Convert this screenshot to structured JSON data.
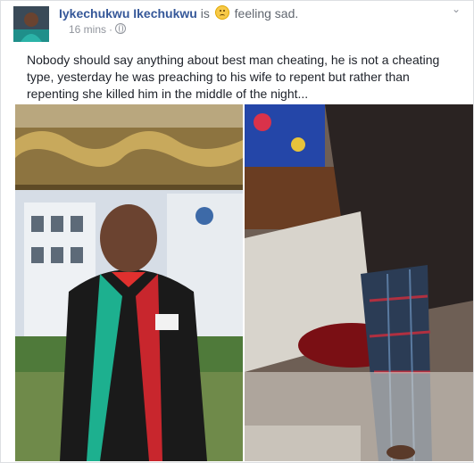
{
  "post": {
    "author": "Iykechukwu Ikechukwu",
    "is_word": "is",
    "feeling": "feeling sad.",
    "time": "16 mins",
    "dot": "·",
    "menu_glyph": "⌄",
    "text": "Nobody should say anything about best man cheating, he is not a cheating type, yesterday he was preaching to his wife to repent but rather than repenting she killed him in the middle of the night..."
  },
  "icons": {
    "feeling": "sad-face-icon",
    "privacy": "globe-icon",
    "menu": "chevron-down-icon"
  },
  "colors": {
    "link": "#365899",
    "text": "#1d2129",
    "meta": "#90949c"
  }
}
